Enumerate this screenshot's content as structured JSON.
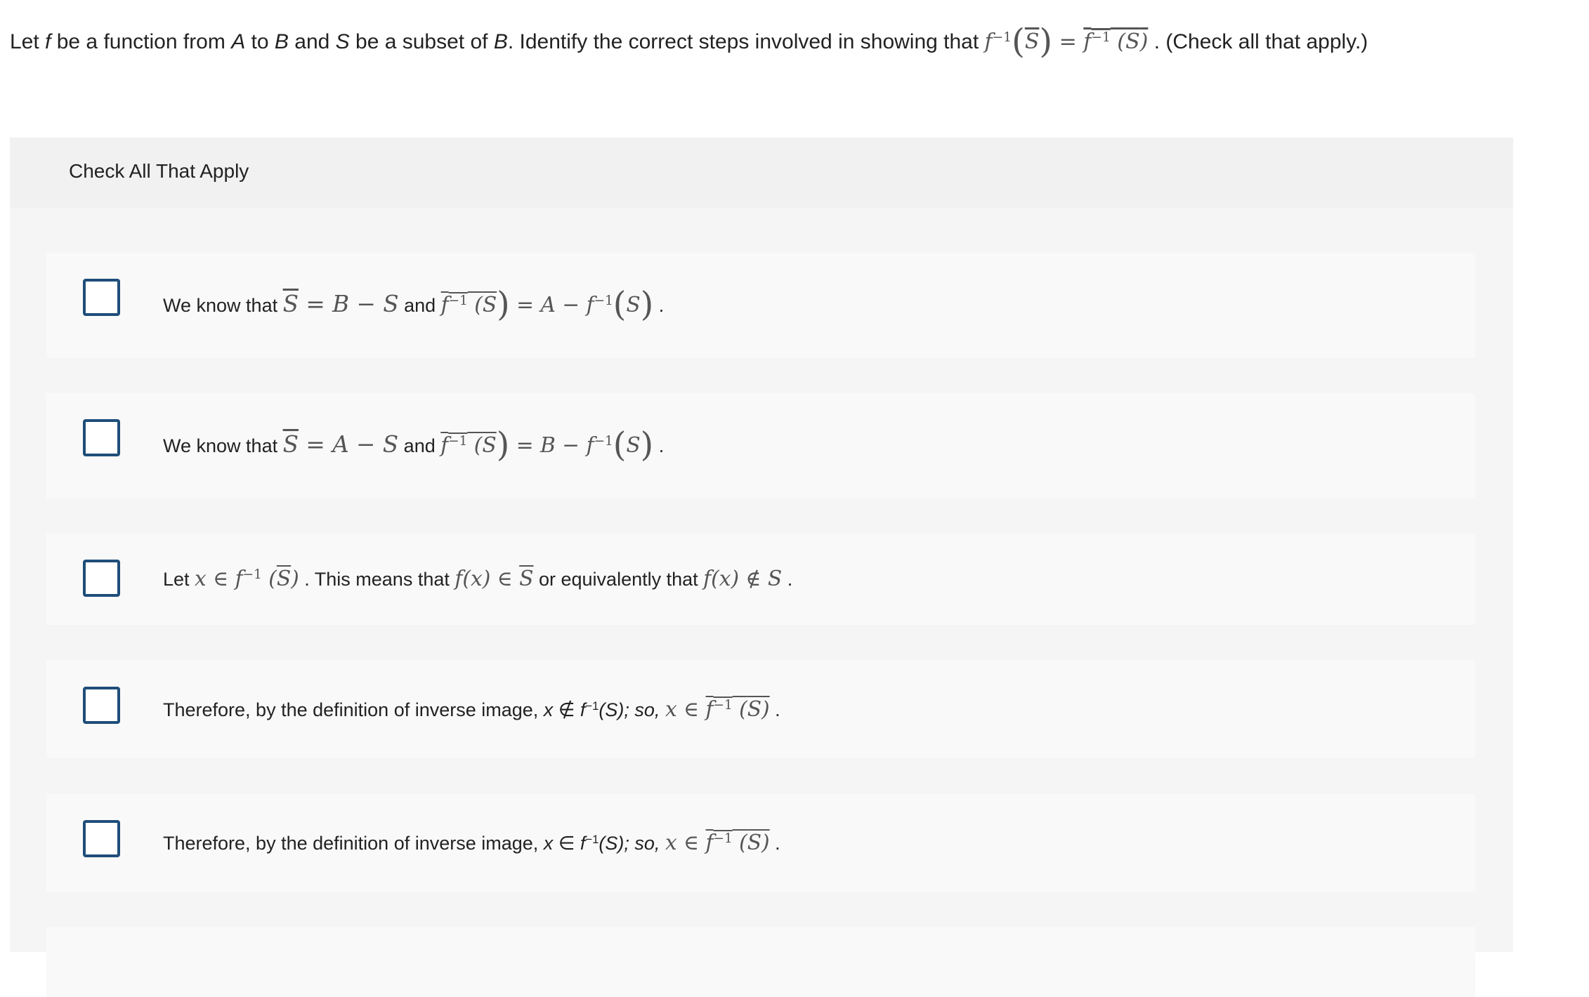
{
  "question": {
    "prefix": "Let ",
    "f": "f",
    "t1": " be a function from ",
    "A": "A",
    "t2": " to ",
    "B": "B",
    "t3": " and ",
    "S": "S",
    "t4": " be a subset of ",
    "B2": "B",
    "t5": ". Identify the correct steps involved in showing that ",
    "lhs_f": "f",
    "exp": "−1",
    "lhs_S": "S",
    "eq": " = ",
    "rhs_f": "f",
    "rhs_S": "S",
    "suffix": " . (Check all that apply.)"
  },
  "panel": {
    "header": "Check All That Apply"
  },
  "options": [
    {
      "lead": "We know that ",
      "m1": "S",
      "m2": " = B − S",
      "and": " and ",
      "m3f": "f",
      "m3s": "S",
      "m4": " = A − ",
      "m5f": "f",
      "m5s": "S",
      "end": " ."
    },
    {
      "lead": "We know that ",
      "m1": "S",
      "m2": " = A − S",
      "and": " and ",
      "m3f": "f",
      "m3s": "S",
      "m4": " = B − ",
      "m5f": "f",
      "m5s": "S",
      "end": " ."
    },
    {
      "lead": "Let ",
      "m1": "x ∈ f",
      "m1s": "S",
      "mid": " . This means that ",
      "m2": "f",
      "m2x": "x",
      "m2b": " ∈ ",
      "m2s": "S",
      "mid2": " or equivalently that ",
      "m3": "f(x) ∉ S",
      "end": " ."
    },
    {
      "lead": "Therefore, by the definition of inverse image, ",
      "x1": "x ∉ f",
      "paren": "(S); so, ",
      "m1": "x ∈ ",
      "m1f": "f",
      "m1s": "S",
      "end": " ."
    },
    {
      "lead": "Therefore, by the definition of inverse image, ",
      "x1": "x ∈ f",
      "paren": "(S); so, ",
      "m1": "x ∈ ",
      "m1f": "f",
      "m1s": "S",
      "end": " ."
    }
  ],
  "colors": {
    "checkbox_border": "#1f4e79",
    "panel_bg": "#f5f5f5",
    "option_bg": "#f9f9f9"
  }
}
